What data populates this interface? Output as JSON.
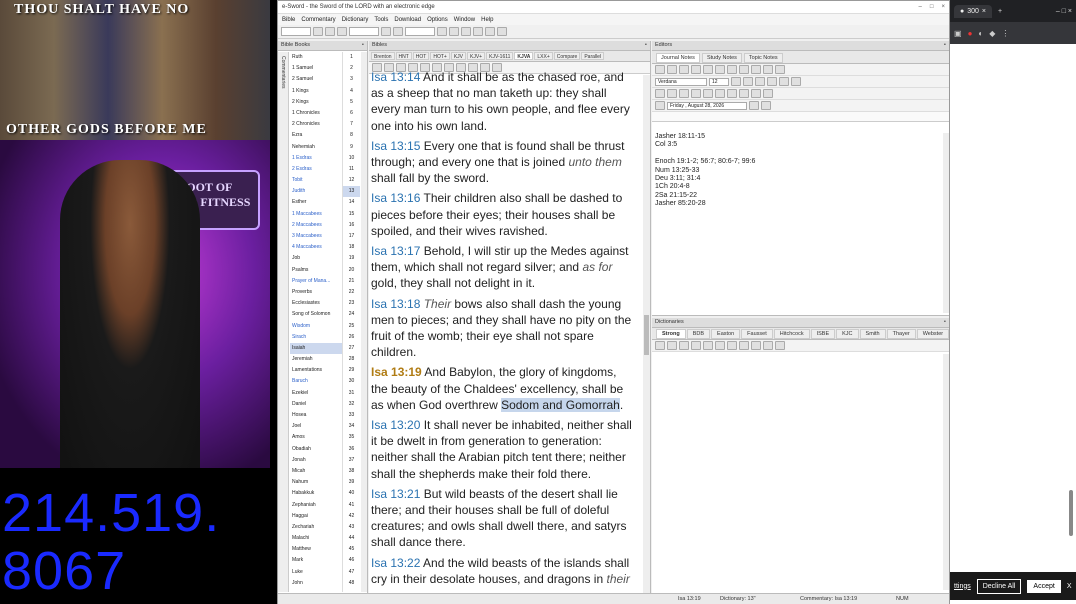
{
  "stream": {
    "banner_line1": "THOU SHALT HAVE NO",
    "banner_line2": "OTHER GODS BEFORE ME",
    "sign_text": "ROOT OF DAVID FITNESS",
    "phone_line1": "214.519.",
    "phone_line2": "8067"
  },
  "app": {
    "title": "e-Sword - the Sword of the LORD with an electronic edge",
    "menu": [
      "Bible",
      "Commentary",
      "Dictionary",
      "Tools",
      "Download",
      "Options",
      "Window",
      "Help"
    ],
    "books_panel": {
      "title": "Bible Books",
      "vtab_label": "Commentaries",
      "books": [
        {
          "name": "Ruth",
          "ap": false
        },
        {
          "name": "1 Samuel",
          "ap": false
        },
        {
          "name": "2 Samuel",
          "ap": false
        },
        {
          "name": "1 Kings",
          "ap": false
        },
        {
          "name": "2 Kings",
          "ap": false
        },
        {
          "name": "1 Chronicles",
          "ap": false
        },
        {
          "name": "2 Chronicles",
          "ap": false
        },
        {
          "name": "Ezra",
          "ap": false
        },
        {
          "name": "Nehemiah",
          "ap": false
        },
        {
          "name": "1 Esdras",
          "ap": true
        },
        {
          "name": "2 Esdras",
          "ap": true
        },
        {
          "name": "Tobit",
          "ap": true
        },
        {
          "name": "Judith",
          "ap": true
        },
        {
          "name": "Esther",
          "ap": false
        },
        {
          "name": "1 Maccabees",
          "ap": true
        },
        {
          "name": "2 Maccabees",
          "ap": true
        },
        {
          "name": "3 Maccabees",
          "ap": true
        },
        {
          "name": "4 Maccabees",
          "ap": true
        },
        {
          "name": "Job",
          "ap": false
        },
        {
          "name": "Psalms",
          "ap": false
        },
        {
          "name": "Prayer of Mana...",
          "ap": true
        },
        {
          "name": "Proverbs",
          "ap": false
        },
        {
          "name": "Ecclesiastes",
          "ap": false
        },
        {
          "name": "Song of Solomon",
          "ap": false
        },
        {
          "name": "Wisdom",
          "ap": true
        },
        {
          "name": "Sirach",
          "ap": true
        },
        {
          "name": "Isaiah",
          "ap": false,
          "sel": true
        },
        {
          "name": "Jeremiah",
          "ap": false
        },
        {
          "name": "Lamentations",
          "ap": false
        },
        {
          "name": "Baruch",
          "ap": true
        },
        {
          "name": "Ezekiel",
          "ap": false
        },
        {
          "name": "Daniel",
          "ap": false
        },
        {
          "name": "Hosea",
          "ap": false
        },
        {
          "name": "Joel",
          "ap": false
        },
        {
          "name": "Amos",
          "ap": false
        },
        {
          "name": "Obadiah",
          "ap": false
        },
        {
          "name": "Jonah",
          "ap": false
        },
        {
          "name": "Micah",
          "ap": false
        },
        {
          "name": "Nahum",
          "ap": false
        },
        {
          "name": "Habakkuk",
          "ap": false
        },
        {
          "name": "Zephaniah",
          "ap": false
        },
        {
          "name": "Haggai",
          "ap": false
        },
        {
          "name": "Zechariah",
          "ap": false
        },
        {
          "name": "Malachi",
          "ap": false
        },
        {
          "name": "Matthew",
          "ap": false
        },
        {
          "name": "Mark",
          "ap": false
        },
        {
          "name": "Luke",
          "ap": false
        },
        {
          "name": "John",
          "ap": false
        }
      ],
      "chapters": [
        "1",
        "2",
        "3",
        "4",
        "5",
        "6",
        "7",
        "8",
        "9",
        "10",
        "11",
        "12",
        "13",
        "14",
        "15",
        "16",
        "17",
        "18",
        "19",
        "20",
        "21",
        "22",
        "23",
        "24",
        "25",
        "26",
        "27",
        "28",
        "29",
        "30",
        "31",
        "32",
        "33",
        "34",
        "35",
        "36",
        "37",
        "38",
        "39",
        "40",
        "41",
        "42",
        "43",
        "44",
        "45",
        "46",
        "47",
        "48"
      ],
      "selected_chapter": "13"
    },
    "bible_panel": {
      "title": "Bibles",
      "tabs": [
        "Brenton",
        "HNT",
        "HOT",
        "HOT+",
        "KJV",
        "KJV+",
        "KJV-1611",
        "KJVA",
        "LXX+",
        "Compare",
        "Parallel"
      ],
      "active_tab": "KJVA",
      "verses": [
        {
          "ref": "Isa 13:14",
          "parts": [
            {
              "t": "And it shall be as the chased roe, and as a sheep that no man taketh up: they shall every man turn to his own people, and flee every one into his own land."
            }
          ]
        },
        {
          "ref": "Isa 13:15",
          "parts": [
            {
              "t": "Every one that is found shall be thrust through; and every one that is joined "
            },
            {
              "t": "unto them",
              "i": true
            },
            {
              "t": " shall fall by the sword."
            }
          ]
        },
        {
          "ref": "Isa 13:16",
          "parts": [
            {
              "t": "Their children also shall be dashed to pieces before their eyes; their houses shall be spoiled, and their wives ravished."
            }
          ]
        },
        {
          "ref": "Isa 13:17",
          "parts": [
            {
              "t": "Behold, I will stir up the Medes against them, which shall not regard silver; and "
            },
            {
              "t": "as for",
              "i": true
            },
            {
              "t": " gold, they shall not delight in it."
            }
          ]
        },
        {
          "ref": "Isa 13:18",
          "parts": [
            {
              "t": "Their",
              "i": true
            },
            {
              "t": " bows also shall dash the young men to pieces; and they shall have no pity on the fruit of the womb; their eye shall not spare children."
            }
          ]
        },
        {
          "ref": "Isa 13:19",
          "cur": true,
          "parts": [
            {
              "t": "And Babylon, the glory of kingdoms, the beauty of the Chaldees' excellency, shall be as when God overthrew "
            },
            {
              "t": "Sodom and Gomorrah",
              "h": true
            },
            {
              "t": "."
            }
          ]
        },
        {
          "ref": "Isa 13:20",
          "parts": [
            {
              "t": "It shall never be inhabited, neither shall it be dwelt in from generation to generation: neither shall the Arabian pitch tent there; neither shall the shepherds make their fold there."
            }
          ]
        },
        {
          "ref": "Isa 13:21",
          "parts": [
            {
              "t": "But wild beasts of the desert shall lie there; and their houses shall be full of doleful creatures; and owls shall dwell there, and satyrs shall dance there."
            }
          ]
        },
        {
          "ref": "Isa 13:22",
          "parts": [
            {
              "t": "And the wild beasts of the islands shall cry in their desolate houses, and dragons in "
            },
            {
              "t": "their",
              "i": true
            }
          ]
        }
      ]
    },
    "editors_panel": {
      "title": "Editors",
      "tabs": [
        "Journal Notes",
        "Study Notes",
        "Topic Notes"
      ],
      "active_tab": "Journal Notes",
      "font": "Verdana",
      "font_size": "12",
      "date": "Friday ,  August  28, 2026",
      "text_lines": [
        "Jasher 18:11-15",
        "Col 3:5",
        "",
        "Enoch 19:1-2; 56:7; 80:6-7; 99:6",
        "Num 13:25-33",
        "Deu 3:11; 31:4",
        "1Ch 20:4-8",
        "2Sa 21:15-22",
        "Jasher 85:20-28"
      ]
    },
    "dict_panel": {
      "title": "Dictionaries",
      "tabs": [
        "Strong",
        "BDB",
        "Easton",
        "Fausset",
        "Hitchcock",
        "ISBE",
        "KJC",
        "Smith",
        "Thayer",
        "Webster"
      ],
      "active_tab": "Strong"
    },
    "status": {
      "verse": "Isa 13:19",
      "dictionary": "Dictionary: 13\"",
      "commentary": "Commentary: Isa 13:19",
      "num": "NUM"
    }
  },
  "browser": {
    "tab_label": "300",
    "cookie_partial": "ttings",
    "decline": "Decline All",
    "accept": "Accept",
    "close": "X"
  },
  "colors": {
    "ref": "#2a72b0",
    "ref_current": "#b07c14",
    "highlight": "#c6d6ec",
    "phone": "#1a2aff"
  }
}
